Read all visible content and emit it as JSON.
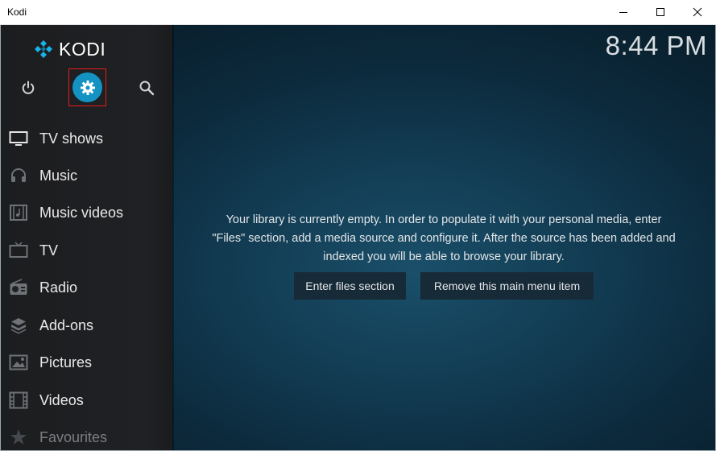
{
  "window": {
    "title": "Kodi",
    "minimize_icon": "minimize-icon",
    "maximize_icon": "maximize-icon",
    "close_icon": "close-icon"
  },
  "header": {
    "logo_text": "KODI",
    "clock": "8:44 PM"
  },
  "toolbar": {
    "power_icon": "power-icon",
    "settings_icon": "gear-icon",
    "search_icon": "search-icon",
    "settings_highlight_color": "#e81b1b",
    "settings_circle_color": "#1493c2"
  },
  "sidebar": {
    "items": [
      {
        "label": "TV shows",
        "icon": "tv-icon"
      },
      {
        "label": "Music",
        "icon": "headphones-icon"
      },
      {
        "label": "Music videos",
        "icon": "music-video-icon"
      },
      {
        "label": "TV",
        "icon": "television-icon"
      },
      {
        "label": "Radio",
        "icon": "radio-icon"
      },
      {
        "label": "Add-ons",
        "icon": "addons-icon"
      },
      {
        "label": "Pictures",
        "icon": "pictures-icon"
      },
      {
        "label": "Videos",
        "icon": "film-icon"
      },
      {
        "label": "Favourites",
        "icon": "star-icon"
      }
    ]
  },
  "main": {
    "message_line1": "Your library is currently empty. In order to populate it with your personal media, enter",
    "message_line2": "\"Files\" section, add a media source and configure it. After the source has been added and",
    "message_line3": "indexed you will be able to browse your library.",
    "enter_files_label": "Enter files section",
    "remove_item_label": "Remove this main menu item"
  }
}
